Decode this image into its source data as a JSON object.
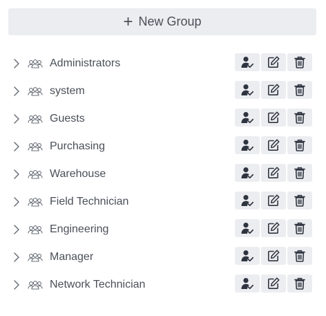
{
  "toolbar": {
    "new_group_label": "New Group",
    "new_group_icon": "plus-icon"
  },
  "groups": [
    {
      "name": "Administrators"
    },
    {
      "name": "system"
    },
    {
      "name": "Guests"
    },
    {
      "name": "Purchasing"
    },
    {
      "name": "Warehouse"
    },
    {
      "name": "Field Technician"
    },
    {
      "name": "Engineering"
    },
    {
      "name": "Manager"
    },
    {
      "name": "Network Technician"
    }
  ],
  "icons": {
    "expand": "chevron-right-icon",
    "group": "users-group-icon",
    "members": "user-check-icon",
    "edit": "edit-icon",
    "delete": "trash-icon"
  },
  "colors": {
    "button_bg": "#ecedf0",
    "text": "#4a4f57",
    "icon": "#2f3540"
  }
}
